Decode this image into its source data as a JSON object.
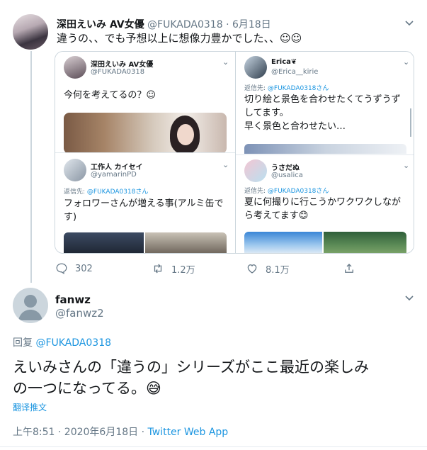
{
  "tweet": {
    "author_name": "深田えいみ AV女優",
    "author_handle": "@FUKADA0318",
    "date": "· 6月18日",
    "text": "違うの、、でも予想以上に想像力豊かでした、、☺☺",
    "replies": "302",
    "retweets": "1.2万",
    "likes": "8.1万",
    "embedded": {
      "left_top": {
        "author_name": "深田えいみ AV女優",
        "author_handle": "@FUKADA0318",
        "text": "今何を考えてるの？☺"
      },
      "left_bottom": {
        "author_name": "工作人 カイセイ",
        "author_handle": "@yamarinPD",
        "reply_to_prefix": "返信先: ",
        "reply_to_handle": "@FUKADA0318さん",
        "text": "フォロワーさんが増える事(アルミ缶です)"
      },
      "right_top": {
        "author_name": "Erica❦",
        "author_handle": "@Erica__kirie",
        "reply_to_prefix": "返信先: ",
        "reply_to_handle": "@FUKADA0318さん",
        "text_lines": [
          "切り絵と景色を合わせたくてうずうず",
          "してます。",
          "早く景色と合わせたい…"
        ]
      },
      "right_bottom": {
        "author_name": "うさだぬ",
        "author_handle": "@usalica",
        "reply_to_prefix": "返信先: ",
        "reply_to_handle": "@FUKADA0318さん",
        "text_lines": [
          "夏に何撮りに行こうかワクワクしなが",
          "ら考えてます😊"
        ]
      }
    }
  },
  "reply": {
    "author_name": "fanwz",
    "author_handle": "@fanwz2",
    "reply_label": "回复 ",
    "reply_to": "@FUKADA0318",
    "text_line1": "えいみさんの「違うの」シリーズがここ最近の楽しみ",
    "text_line2": "の一つになってる。😅",
    "translate": "翻译推文",
    "timestamp": "上午8:51 · 2020年6月18日 · ",
    "source": "Twitter Web App"
  },
  "colors": {
    "link": "#1b95e0",
    "muted": "#657786",
    "border": "#ccd6dd"
  }
}
